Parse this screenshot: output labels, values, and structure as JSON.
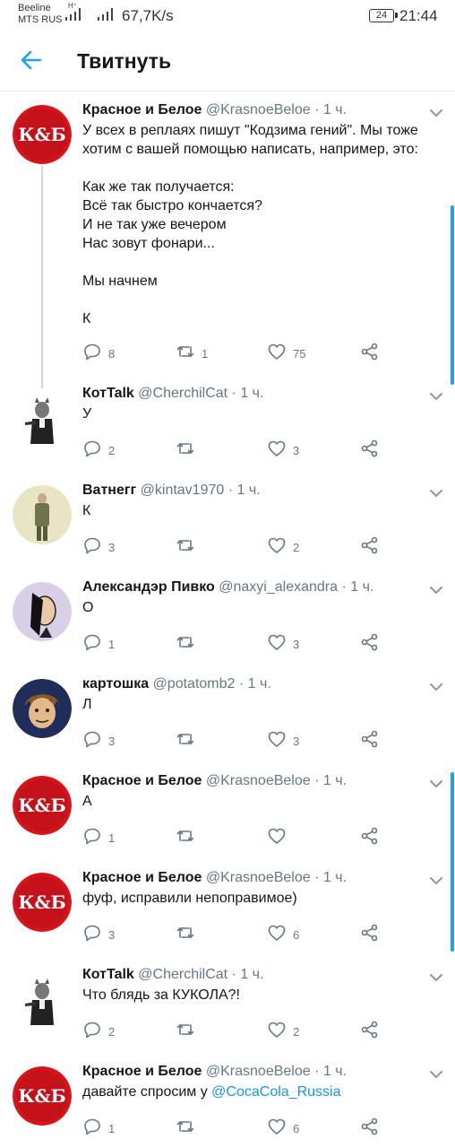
{
  "status": {
    "carrier_top": "Beeline",
    "carrier_bottom": "MTS RUS",
    "net_tag": "H⁺",
    "speed": "67,7K/s",
    "battery": "24",
    "time": "21:44"
  },
  "header": {
    "title": "Твитнуть"
  },
  "tweets": [
    {
      "name": "Красное и Белое",
      "handle": "@KrasnoeBeloe · 1 ч.",
      "lines": [
        "У всех в реплаях пишут \"Кодзима гений\". Мы тоже хотим с вашей помощью написать, например, это:",
        "",
        "Как же так получается:",
        "Всё так быстро кончается?",
        "И не так уже вечером",
        "Нас зовут фонари...",
        "",
        "Мы начнем",
        "",
        "К"
      ],
      "replies": "8",
      "retweets": "1",
      "likes": "75"
    },
    {
      "name": "КотTalk",
      "handle": "@CherchilCat · 1 ч.",
      "lines": [
        "У"
      ],
      "replies": "2",
      "retweets": "",
      "likes": "3"
    },
    {
      "name": "Ватнегг",
      "handle": "@kintav1970 · 1 ч.",
      "lines": [
        "К"
      ],
      "replies": "3",
      "retweets": "",
      "likes": "2"
    },
    {
      "name": "Александэр Пивко",
      "handle": "@naxyi_alexandra · 1 ч.",
      "lines": [
        "О"
      ],
      "replies": "1",
      "retweets": "",
      "likes": "3"
    },
    {
      "name": "картошка",
      "handle": "@potatomb2 · 1 ч.",
      "lines": [
        "Л"
      ],
      "replies": "3",
      "retweets": "",
      "likes": "3"
    },
    {
      "name": "Красное и Белое",
      "handle": "@KrasnoeBeloe · 1 ч.",
      "lines": [
        "А"
      ],
      "replies": "1",
      "retweets": "",
      "likes": ""
    },
    {
      "name": "Красное и Белое",
      "handle": "@KrasnoeBeloe · 1 ч.",
      "lines": [
        "фуф, исправили непоправимое)"
      ],
      "replies": "3",
      "retweets": "",
      "likes": "6"
    },
    {
      "name": "КотTalk",
      "handle": "@CherchilCat · 1 ч.",
      "lines": [
        "Что блядь за КУКОЛА?!"
      ],
      "replies": "2",
      "retweets": "",
      "likes": "2"
    },
    {
      "name": "Красное и Белое",
      "handle": "@KrasnoeBeloe · 1 ч.",
      "text_prefix": "давайте спросим у ",
      "mention": "@CocaCola_Russia",
      "replies": "1",
      "retweets": "",
      "likes": "6"
    }
  ],
  "avatars": {
    "kb_logo_text": "К&Б"
  },
  "icons": {
    "back": "arrow-left-icon",
    "chevron": "chevron-down-icon",
    "reply": "reply-icon",
    "retweet": "retweet-icon",
    "like": "heart-icon",
    "share": "share-icon"
  },
  "colors": {
    "brand": "#1da1f2",
    "link": "#1b95e0",
    "secondary": "#657786",
    "kb_red": "#d7141a"
  }
}
